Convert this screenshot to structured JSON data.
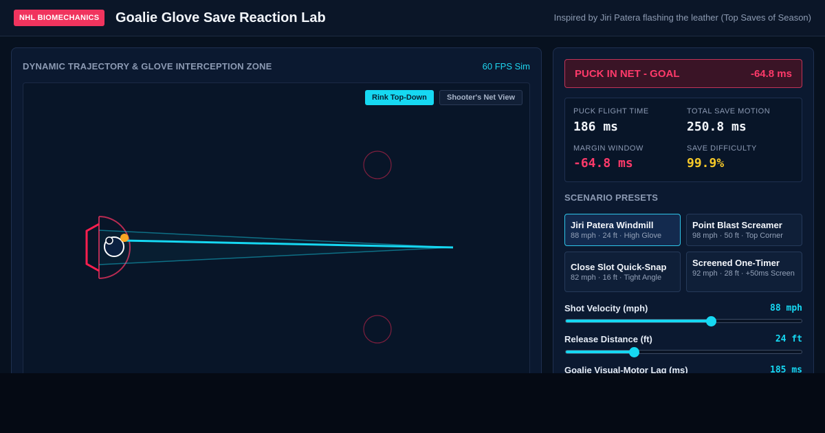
{
  "header": {
    "badge": "NHL BIOMECHANICS",
    "title": "Goalie Glove Save Reaction Lab",
    "inspired": "Inspired by Jiri Patera flashing the leather (Top Saves of Season)"
  },
  "sim_panel": {
    "title": "DYNAMIC TRAJECTORY & GLOVE INTERCEPTION ZONE",
    "fps": "60 FPS Sim",
    "view_buttons": [
      "Rink Top-Down",
      "Shooter's Net View"
    ],
    "active_view": "Rink Top-Down"
  },
  "colors": {
    "accent": "#16d8f2",
    "goal_red": "#ff3a6a",
    "puck_orange": "#f7a623",
    "difficulty_yellow": "#f7c928"
  },
  "result": {
    "label": "PUCK IN NET - GOAL",
    "value": "-64.8 ms"
  },
  "stats": [
    {
      "label": "PUCK FLIGHT TIME",
      "value": "186 ms",
      "tone": "white"
    },
    {
      "label": "TOTAL SAVE MOTION",
      "value": "250.8 ms",
      "tone": "white"
    },
    {
      "label": "MARGIN WINDOW",
      "value": "-64.8 ms",
      "tone": "red"
    },
    {
      "label": "SAVE DIFFICULTY",
      "value": "99.9%",
      "tone": "yellow"
    }
  ],
  "presets": {
    "title": "SCENARIO PRESETS",
    "items": [
      {
        "name": "Jiri Patera Windmill",
        "meta": "88 mph · 24 ft · High Glove",
        "active": true
      },
      {
        "name": "Point Blast Screamer",
        "meta": "98 mph · 50 ft · Top Corner",
        "active": false
      },
      {
        "name": "Close Slot Quick-Snap",
        "meta": "82 mph · 16 ft · Tight Angle",
        "active": false
      },
      {
        "name": "Screened One-Timer",
        "meta": "92 mph · 28 ft · +50ms Screen",
        "active": false
      }
    ]
  },
  "sliders": [
    {
      "label": "Shot Velocity (mph)",
      "value": "88 mph",
      "fraction": 0.615
    },
    {
      "label": "Release Distance (ft)",
      "value": "24 ft",
      "fraction": 0.29
    },
    {
      "label": "Goalie Visual-Motor Lag (ms)",
      "value": "185 ms",
      "fraction": 0.5
    }
  ]
}
